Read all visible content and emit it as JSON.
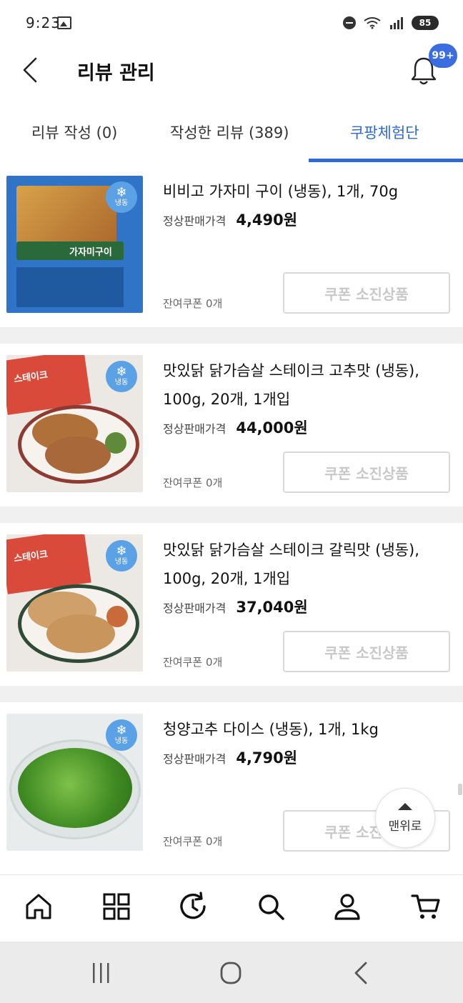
{
  "status_bar": {
    "time": "9:23",
    "battery": "85"
  },
  "header": {
    "title": "리뷰 관리",
    "notification_count": "99+"
  },
  "tabs": [
    {
      "label": "리뷰 작성 (0)",
      "active": false
    },
    {
      "label": "작성한 리뷰 (389)",
      "active": false
    },
    {
      "label": "쿠팡체험단",
      "active": true
    }
  ],
  "colors": {
    "accent": "#2f6ad9",
    "badge": "#3a6ee0",
    "frozen_badge": "#5aa1e6"
  },
  "frozen_badge": "냉동",
  "products": [
    {
      "name": "비비고 가자미 구이 (냉동), 1개, 70g",
      "price_label": "정상판매가격",
      "price": "4,490원",
      "coupon_left": "잔여쿠폰 0개",
      "button": "쿠폰 소진상품",
      "thumbnail_text": "가자미구이"
    },
    {
      "name": "맛있닭 닭가슴살 스테이크 고추맛 (냉동), 100g, 20개, 1개입",
      "price_label": "정상판매가격",
      "price": "44,000원",
      "coupon_left": "잔여쿠폰 0개",
      "button": "쿠폰 소진상품",
      "thumbnail_text": "스테이크"
    },
    {
      "name": "맛있닭 닭가슴살 스테이크 갈릭맛 (냉동), 100g, 20개, 1개입",
      "price_label": "정상판매가격",
      "price": "37,040원",
      "coupon_left": "잔여쿠폰 0개",
      "button": "쿠폰 소진상품",
      "thumbnail_text": "스테이크"
    },
    {
      "name": "청양고추 다이스 (냉동), 1개, 1kg",
      "price_label": "정상판매가격",
      "price": "4,790원",
      "coupon_left": "잔여쿠폰 0개",
      "button": "쿠폰 소진상품"
    }
  ],
  "scroll_top": {
    "label": "맨위로"
  },
  "bottom_nav": [
    "home-icon",
    "category-grid-icon",
    "recent-history-icon",
    "search-icon",
    "my-account-icon",
    "cart-icon"
  ],
  "system_nav": [
    "recent-apps-icon",
    "home-circle-icon",
    "back-icon"
  ]
}
